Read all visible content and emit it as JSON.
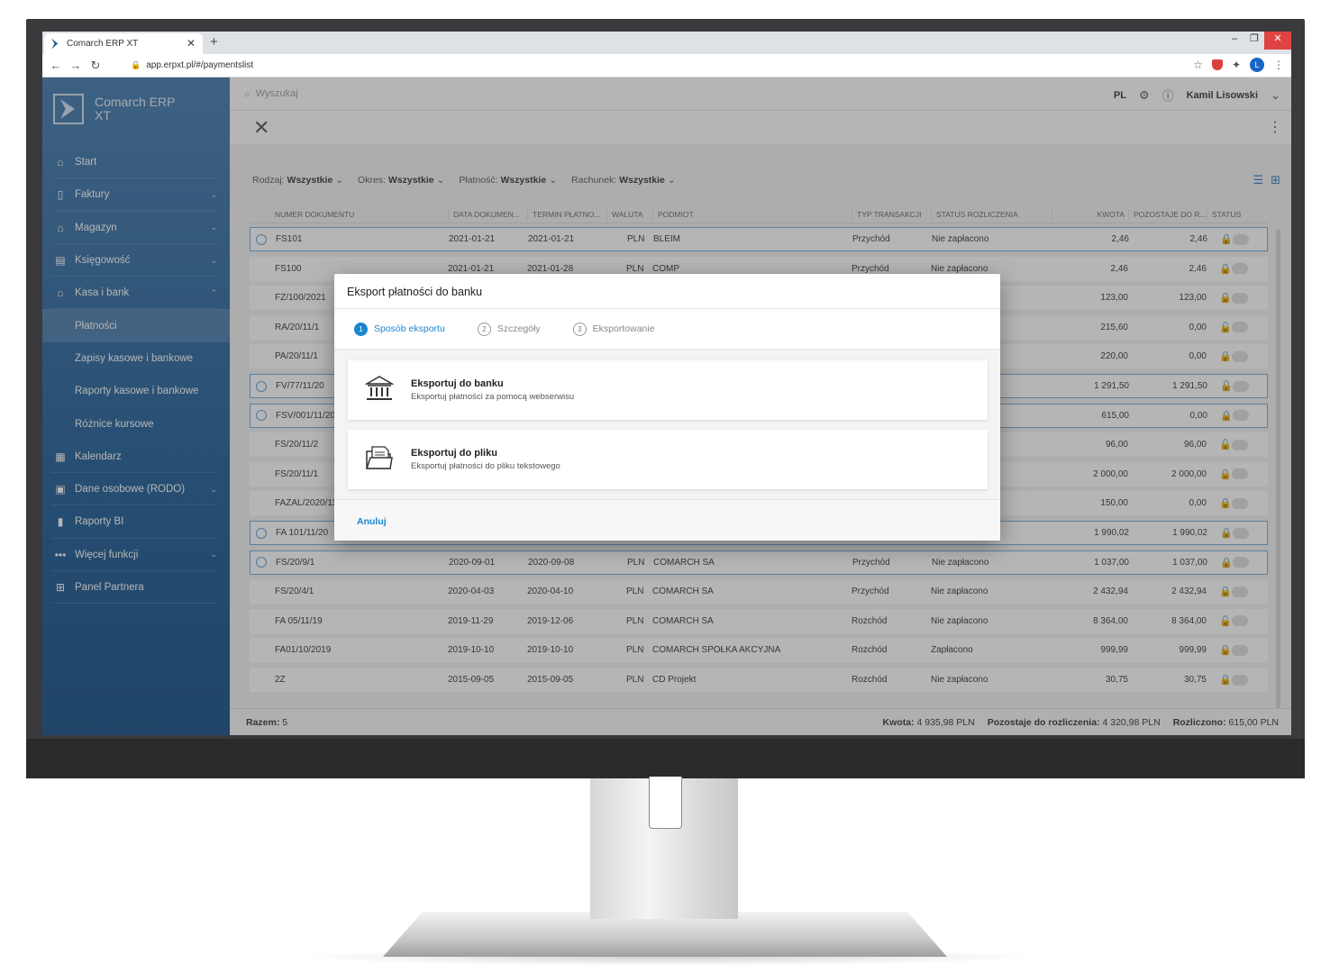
{
  "browser": {
    "tab_title": "Comarch ERP XT",
    "url": "app.erpxt.pl/#/paymentslist",
    "profile_initial": "L"
  },
  "sidebar": {
    "brand_line1": "Comarch ERP",
    "brand_line2": "XT",
    "items": [
      {
        "label": "Start",
        "icon": "home-icon"
      },
      {
        "label": "Faktury",
        "icon": "invoice-icon"
      },
      {
        "label": "Magazyn",
        "icon": "warehouse-icon"
      },
      {
        "label": "Księgowość",
        "icon": "accounting-icon"
      },
      {
        "label": "Kasa i bank",
        "icon": "bank-icon"
      },
      {
        "label": "Płatności"
      },
      {
        "label": "Zapisy kasowe i bankowe"
      },
      {
        "label": "Raporty kasowe i bankowe"
      },
      {
        "label": "Różnice kursowe"
      },
      {
        "label": "Kalendarz",
        "icon": "calendar-icon"
      },
      {
        "label": "Dane osobowe (RODO)",
        "icon": "person-icon"
      },
      {
        "label": "Raporty BI",
        "icon": "chart-icon"
      },
      {
        "label": "Więcej funkcji",
        "icon": "dots-icon"
      },
      {
        "label": "Panel Partnera",
        "icon": "store-icon"
      }
    ]
  },
  "topbar": {
    "search_placeholder": "Wyszukaj",
    "language": "PL",
    "user_name": "Kamil Lisowski"
  },
  "filters": [
    {
      "label": "Rodzaj:",
      "value": "Wszystkie"
    },
    {
      "label": "Okres:",
      "value": "Wszystkie"
    },
    {
      "label": "Płatność:",
      "value": "Wszystkie"
    },
    {
      "label": "Rachunek:",
      "value": "Wszystkie"
    }
  ],
  "table": {
    "headers": [
      "NUMER DOKUMENTU",
      "DATA DOKUMEN...",
      "TERMIN PŁATNO...",
      "WALUTA",
      "PODMIOT",
      "TYP TRANSAKCJI",
      "STATUS ROZLICZENIA",
      "KWOTA",
      "POZOSTAJE DO R...",
      "STATUS"
    ],
    "rows": [
      {
        "doc": "FS101",
        "date": "2021-01-21",
        "due": "2021-01-21",
        "cur": "PLN",
        "party": "BLEIM",
        "type": "Przychód",
        "status": "Nie zapłacono",
        "amount": "2,46",
        "remain": "2,46",
        "lock": "🔒",
        "sel": true
      },
      {
        "doc": "FS100",
        "date": "2021-01-21",
        "due": "2021-01-28",
        "cur": "PLN",
        "party": "COMP",
        "type": "Przychód",
        "status": "Nie zapłacono",
        "amount": "2,46",
        "remain": "2,46",
        "lock": "🔒",
        "sel": false
      },
      {
        "doc": "FZ/100/2021",
        "date": "",
        "due": "",
        "cur": "",
        "party": "",
        "type": "",
        "status": "",
        "amount": "123,00",
        "remain": "123,00",
        "lock": "🔒",
        "sel": false
      },
      {
        "doc": "RA/20/11/1",
        "date": "",
        "due": "",
        "cur": "",
        "party": "",
        "type": "",
        "status": "",
        "amount": "215,60",
        "remain": "0,00",
        "lock": "🔓",
        "sel": false
      },
      {
        "doc": "PA/20/11/1",
        "date": "",
        "due": "",
        "cur": "",
        "party": "",
        "type": "",
        "status": "",
        "amount": "220,00",
        "remain": "0,00",
        "lock": "🔒",
        "sel": false
      },
      {
        "doc": "FV/77/11/20",
        "date": "",
        "due": "",
        "cur": "",
        "party": "",
        "type": "",
        "status": "",
        "amount": "1 291,50",
        "remain": "1 291,50",
        "lock": "🔓",
        "sel": true
      },
      {
        "doc": "FSV/001/11/20",
        "date": "",
        "due": "",
        "cur": "",
        "party": "",
        "type": "",
        "status": "",
        "amount": "615,00",
        "remain": "0,00",
        "lock": "🔒",
        "sel": true
      },
      {
        "doc": "FS/20/11/2",
        "date": "",
        "due": "",
        "cur": "",
        "party": "",
        "type": "",
        "status": "",
        "amount": "96,00",
        "remain": "96,00",
        "lock": "🔓",
        "sel": false
      },
      {
        "doc": "FS/20/11/1",
        "date": "",
        "due": "",
        "cur": "",
        "party": "",
        "type": "",
        "status": "",
        "amount": "2 000,00",
        "remain": "2 000,00",
        "lock": "🔒",
        "sel": false
      },
      {
        "doc": "FAZAL/2020/11",
        "date": "",
        "due": "",
        "cur": "",
        "party": "",
        "type": "",
        "status": "",
        "amount": "150,00",
        "remain": "0,00",
        "lock": "🔒",
        "sel": false
      },
      {
        "doc": "FA 101/11/20",
        "date": "",
        "due": "",
        "cur": "",
        "party": "",
        "type": "",
        "status": "",
        "amount": "1 990,02",
        "remain": "1 990,02",
        "lock": "🔒",
        "sel": true
      },
      {
        "doc": "FS/20/9/1",
        "date": "2020-09-01",
        "due": "2020-09-08",
        "cur": "PLN",
        "party": "COMARCH SA",
        "type": "Przychód",
        "status": "Nie zapłacono",
        "amount": "1 037,00",
        "remain": "1 037,00",
        "lock": "🔒",
        "sel": true
      },
      {
        "doc": "FS/20/4/1",
        "date": "2020-04-03",
        "due": "2020-04-10",
        "cur": "PLN",
        "party": "COMARCH SA",
        "type": "Przychód",
        "status": "Nie zapłacono",
        "amount": "2 432,94",
        "remain": "2 432,94",
        "lock": "🔒",
        "sel": false
      },
      {
        "doc": "FA 05/11/19",
        "date": "2019-11-29",
        "due": "2019-12-06",
        "cur": "PLN",
        "party": "COMARCH SA",
        "type": "Rozchód",
        "status": "Nie zapłacono",
        "amount": "8 364,00",
        "remain": "8 364,00",
        "lock": "🔓",
        "sel": false
      },
      {
        "doc": "FA01/10/2019",
        "date": "2019-10-10",
        "due": "2019-10-10",
        "cur": "PLN",
        "party": "COMARCH SPÓŁKA AKCYJNA",
        "type": "Rozchód",
        "status": "Zapłacono",
        "amount": "999,99",
        "remain": "999,99",
        "lock": "🔒",
        "sel": false
      },
      {
        "doc": "2Z",
        "date": "2015-09-05",
        "due": "2015-09-05",
        "cur": "PLN",
        "party": "CD Projekt",
        "type": "Rozchód",
        "status": "Nie zapłacono",
        "amount": "30,75",
        "remain": "30,75",
        "lock": "🔒",
        "sel": false
      }
    ]
  },
  "footer": {
    "total_label": "Razem:",
    "total_value": "5",
    "amount_label": "Kwota:",
    "amount_value": "4 935,98 PLN",
    "remain_label": "Pozostaje do rozliczenia:",
    "remain_value": "4 320,98 PLN",
    "settled_label": "Rozliczono:",
    "settled_value": "615,00 PLN"
  },
  "dialog": {
    "title": "Eksport płatności do banku",
    "steps": [
      {
        "num": "1",
        "label": "Sposób eksportu"
      },
      {
        "num": "2",
        "label": "Szczegóły"
      },
      {
        "num": "3",
        "label": "Eksportowanie"
      }
    ],
    "options": [
      {
        "title": "Eksportuj do banku",
        "desc": "Eksportuj płatności za pomocą webserwisu"
      },
      {
        "title": "Eksportuj do pliku",
        "desc": "Eksportuj płatności do pliku tekstowego"
      }
    ],
    "cancel_label": "Anuluj"
  },
  "colors": {
    "accent": "#1a86d0",
    "sidebar": "#1a5a94"
  }
}
